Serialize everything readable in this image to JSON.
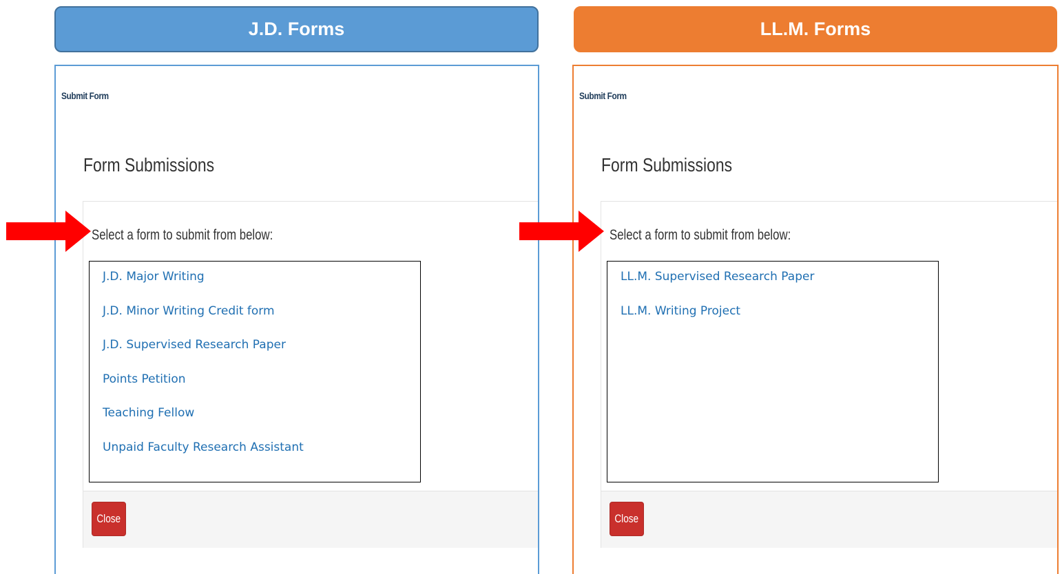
{
  "jd": {
    "header": "J.D. Forms",
    "submit_form": "Submit Form",
    "title": "Form Submissions",
    "prompt": "Select a form to submit from below:",
    "forms": [
      "J.D. Major Writing",
      "J.D. Minor Writing Credit form",
      "J.D. Supervised Research Paper",
      "Points Petition",
      "Teaching Fellow",
      "Unpaid Faculty Research Assistant"
    ],
    "close_label": "Close"
  },
  "llm": {
    "header": "LL.M. Forms",
    "submit_form": "Submit Form",
    "title": "Form Submissions",
    "prompt": "Select a form to submit from below:",
    "forms": [
      "LL.M. Supervised Research Paper",
      "LL.M. Writing Project"
    ],
    "close_label": "Close"
  },
  "colors": {
    "jd_accent": "#5b9bd5",
    "llm_accent": "#ed7d31",
    "arrow": "#ff0000",
    "link": "#1f6fb2",
    "close_button": "#c9302c"
  },
  "icons": {
    "pointer": "red-arrow-icon"
  }
}
